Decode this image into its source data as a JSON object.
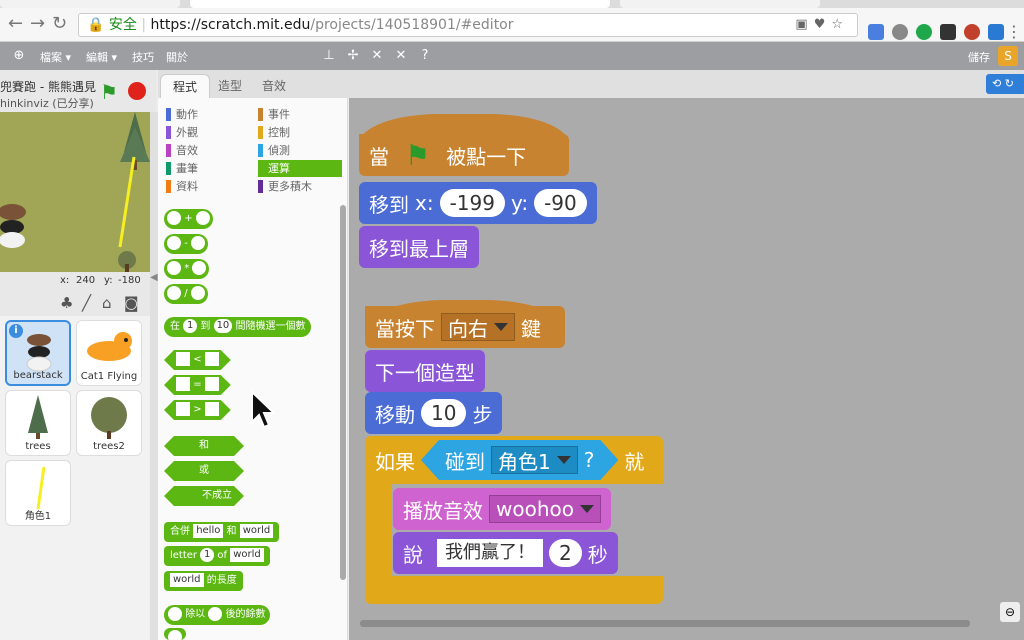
{
  "browser": {
    "secure_label": "安全",
    "url_host": "https://scratch.mit.edu",
    "url_path": "/projects/140518901/#editor"
  },
  "menu": {
    "file": "檔案 ▾",
    "edit": "編輯 ▾",
    "tips": "技巧",
    "about": "關於",
    "save": "儲存"
  },
  "project": {
    "title": "兜賽跑 - 熊熊遇見",
    "author": "hinkinviz (已分享)"
  },
  "stage_coords": {
    "x_label": "x:",
    "x": "240",
    "y_label": "y:",
    "y": "-180"
  },
  "tabs": [
    "程式",
    "造型",
    "音效"
  ],
  "categories": [
    {
      "label": "動作",
      "color": "#4a6cd4"
    },
    {
      "label": "外觀",
      "color": "#8a55d7"
    },
    {
      "label": "音效",
      "color": "#bb42c3"
    },
    {
      "label": "畫筆",
      "color": "#0e9a6c"
    },
    {
      "label": "資料",
      "color": "#ee7d16"
    },
    {
      "label": "事件",
      "color": "#c88330"
    },
    {
      "label": "控制",
      "color": "#e1a91a"
    },
    {
      "label": "偵測",
      "color": "#2ca5e2"
    },
    {
      "label": "運算",
      "color": "#5cb712"
    },
    {
      "label": "更多積木",
      "color": "#632d99"
    }
  ],
  "palette": {
    "plus": "+",
    "minus": "-",
    "times": "*",
    "divide": "/",
    "random_pre": "在",
    "random_a": "1",
    "random_mid": "到",
    "random_b": "10",
    "random_post": "間隨機選一個數",
    "lt": "<",
    "eq": "=",
    "gt": ">",
    "and": "和",
    "or": "或",
    "not": "不成立",
    "join": "合併",
    "join_a": "hello",
    "join_mid": "和",
    "join_b": "world",
    "letter": "letter",
    "letter_n": "1",
    "letter_of": "of",
    "letter_w": "world",
    "length_w": "world",
    "length_post": "的長度",
    "mod_mid": "除以",
    "mod_post": "後的餘數"
  },
  "sprites": [
    {
      "name": "bearstack"
    },
    {
      "name": "Cat1 Flying"
    },
    {
      "name": "trees"
    },
    {
      "name": "trees2"
    },
    {
      "name": "角色1"
    }
  ],
  "script1": {
    "hat_pre": "當",
    "hat_post": "被點一下",
    "goto": "移到",
    "x_label": "x:",
    "x": "-199",
    "y_label": "y:",
    "y": "-90",
    "front": "移到最上層"
  },
  "script2": {
    "hat_pre": "當按下",
    "key": "向右",
    "hat_post": "鍵",
    "next": "下一個造型",
    "move": "移動",
    "steps": "10",
    "steps_post": "步",
    "if": "如果",
    "touching": "碰到",
    "touch_target": "角色1",
    "q": "?",
    "then": "就",
    "play": "播放音效",
    "sound": "woohoo",
    "say": "說",
    "say_text": "我們贏了！",
    "secs": "2",
    "secs_post": "秒"
  }
}
